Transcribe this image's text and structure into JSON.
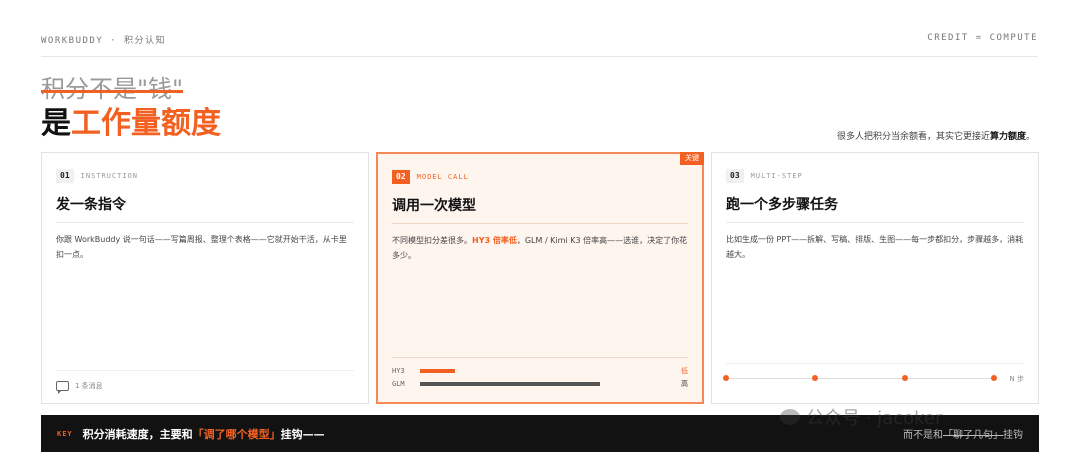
{
  "header": {
    "left": "WORKBUDDY · 积分认知",
    "right": "CREDIT = COMPUTE"
  },
  "heading": {
    "struck": "积分不是\"钱\"",
    "prefix": "是",
    "accent": "工作量额度"
  },
  "tagline": {
    "text": "很多人把积分当余额看，其实它更接近",
    "bold": "算力额度",
    "end": "。"
  },
  "cards": [
    {
      "num": "01",
      "kicker": "INSTRUCTION",
      "title": "发一条指令",
      "desc": "你跟 WorkBuddy 说一句话——写篇周报、整理个表格——它就开始干活，从卡里扣一点。",
      "footer": "1 条消息",
      "icon": "chat-icon"
    },
    {
      "num": "02",
      "kicker": "MODEL CALL",
      "badge": "关键",
      "title": "调用一次模型",
      "desc_pre": "不同模型扣分差很多。",
      "desc_hl": "HY3 倍率低",
      "desc_post": "，GLM / Kimi K3 倍率高——选谁，决定了你花多少。",
      "rates": [
        {
          "label": "HY3",
          "level": "低",
          "fraction": 0.14,
          "color": "#f26122"
        },
        {
          "label": "GLM",
          "level": "高",
          "fraction": 0.72,
          "color": "#555555"
        }
      ]
    },
    {
      "num": "03",
      "kicker": "MULTI-STEP",
      "title": "跑一个多步骤任务",
      "desc": "比如生成一份 PPT——拆解、写稿、排版、生图——每一步都扣分，步骤越多，消耗越大。",
      "steps_label": "N 步",
      "step_count": 4
    }
  ],
  "keybar": {
    "key": "KEY",
    "msg_pre": "积分消耗速度，主要和",
    "msg_hl": "「调了哪个模型」",
    "msg_post": "挂钩——",
    "right_pre": "而不是和",
    "right_strike": "「聊了几句」",
    "right_post": "挂钩"
  },
  "watermark": "公众号 · jacoker",
  "colors": {
    "accent": "#f26122",
    "dark": "#121212"
  }
}
